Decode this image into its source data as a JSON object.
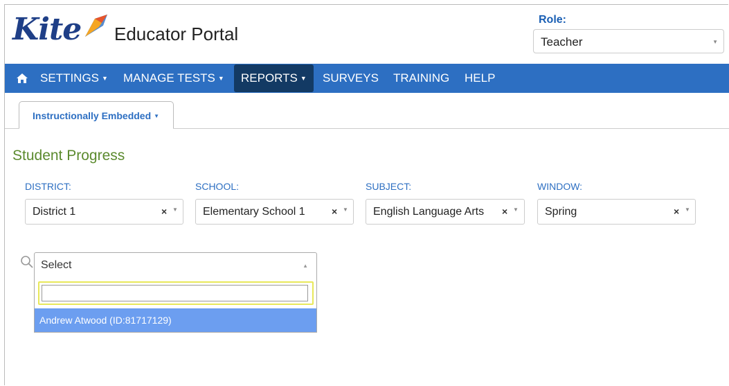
{
  "header": {
    "logo_word": "Kite",
    "portal_title": "Educator Portal",
    "role_label": "Role:",
    "role_value": "Teacher"
  },
  "nav": {
    "items": [
      {
        "label": "SETTINGS",
        "dropdown": true
      },
      {
        "label": "MANAGE TESTS",
        "dropdown": true
      },
      {
        "label": "REPORTS",
        "dropdown": true,
        "active": true
      },
      {
        "label": "SURVEYS",
        "dropdown": false
      },
      {
        "label": "TRAINING",
        "dropdown": false
      },
      {
        "label": "HELP",
        "dropdown": false
      }
    ],
    "bar_color": "#2d6fc2",
    "active_color": "#133a64"
  },
  "tabs": [
    {
      "label": "Instructionally Embedded",
      "active": true
    }
  ],
  "page": {
    "title": "Student Progress"
  },
  "filters": {
    "district": {
      "label": "DISTRICT:",
      "value": "District 1"
    },
    "school": {
      "label": "SCHOOL:",
      "value": "Elementary School 1"
    },
    "subject": {
      "label": "SUBJECT:",
      "value": "English Language Arts"
    },
    "window": {
      "label": "WINDOW:",
      "value": "Spring"
    }
  },
  "student_select": {
    "value": "Select",
    "search_value": "",
    "options": [
      "Andrew Atwood (ID:81717129)"
    ],
    "highlight_color": "#6c9ef0"
  },
  "icons": {
    "home": "home-icon",
    "search": "search-icon",
    "clear": "×",
    "caret": "▼"
  }
}
